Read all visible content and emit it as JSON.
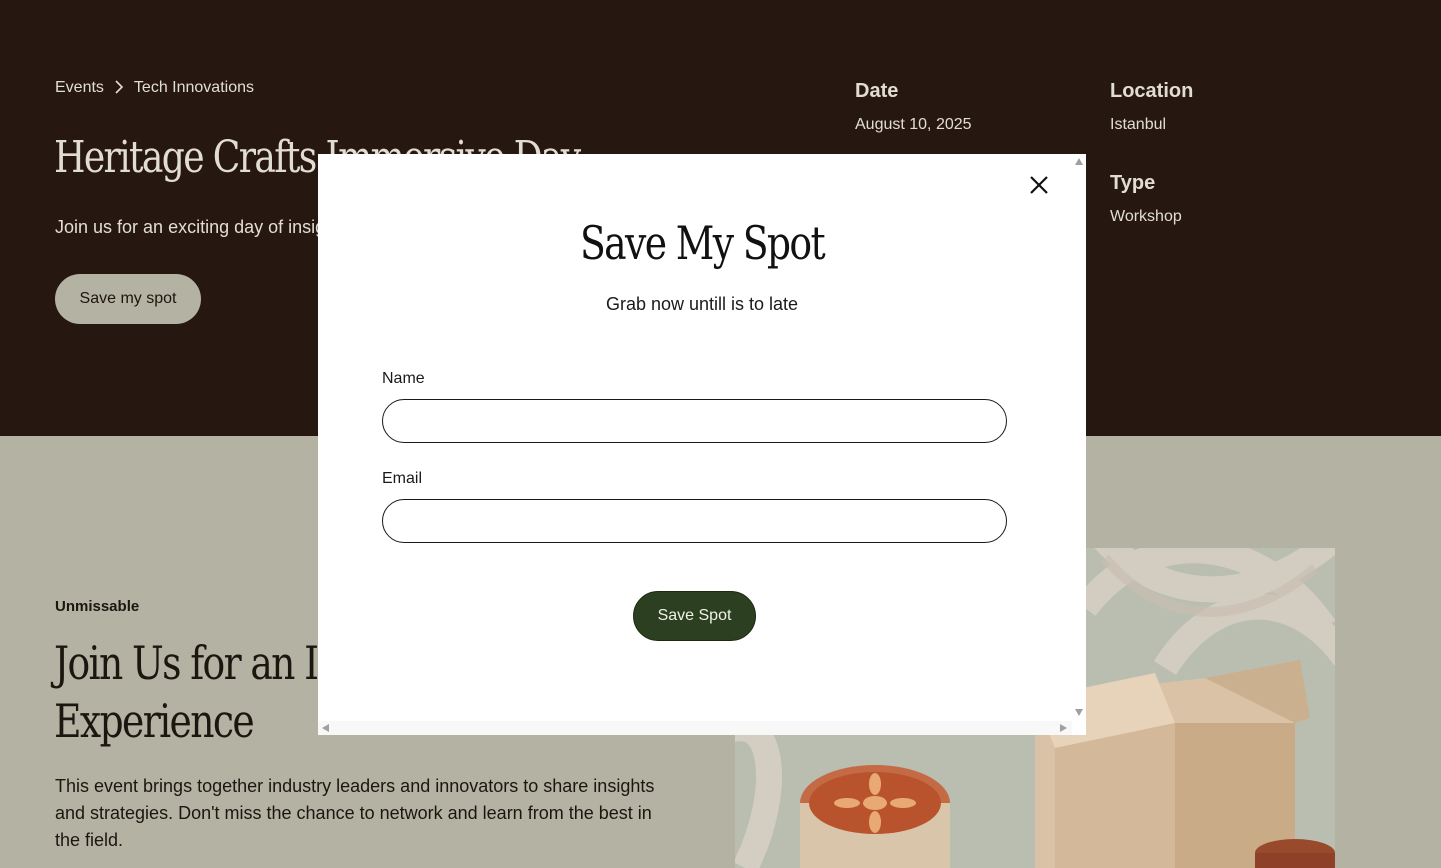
{
  "breadcrumb": {
    "items": [
      "Events",
      "Tech Innovations"
    ],
    "separator": "›"
  },
  "hero": {
    "title": "Heritage Crafts Immersive Day",
    "description": "Join us for an exciting day of insights",
    "cta_label": "Save my spot"
  },
  "meta": {
    "date_label": "Date",
    "date_value": "August 10, 2025",
    "location_label": "Location",
    "location_value": "Istanbul",
    "type_label": "Type",
    "type_value": "Workshop"
  },
  "section": {
    "eyebrow": "Unmissable",
    "title_line1": "Join Us for an Inspiring",
    "title_line2": "Experience",
    "description": "This event brings together industry leaders and innovators to share insights and strategies. Don't miss the chance to network and learn from the best in the field."
  },
  "modal": {
    "title": "Save My Spot",
    "subtitle": "Grab now untill is to late",
    "name_label": "Name",
    "name_value": "",
    "email_label": "Email",
    "email_value": "",
    "submit_label": "Save Spot"
  },
  "icons": {
    "close": "close-icon",
    "breadcrumb_separator": "chevron-right-icon"
  },
  "colors": {
    "hero_bg": "#261811",
    "section_bg": "#b4b2a2",
    "modal_bg": "#ffffff",
    "submit_bg": "#2c4021",
    "hero_text": "#e2ddd2"
  }
}
